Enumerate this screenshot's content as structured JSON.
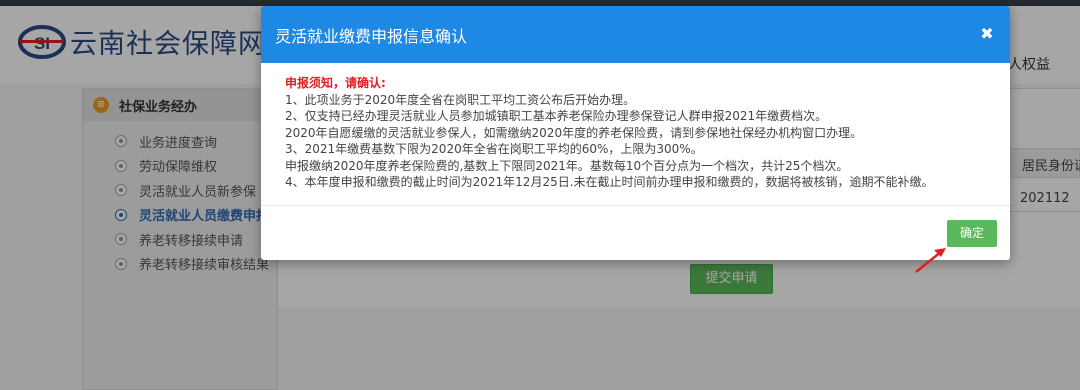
{
  "header": {
    "site_title": "云南社会保障网上",
    "rights_link": "人权益"
  },
  "sidebar": {
    "title": "社保业务经办",
    "items": [
      {
        "label": "业务进度查询"
      },
      {
        "label": "劳动保障维权"
      },
      {
        "label": "灵活就业人员新参保"
      },
      {
        "label": "灵活就业人员缴费申报",
        "active": true
      },
      {
        "label": "养老转移接续申请"
      },
      {
        "label": "养老转移接续审核结果"
      }
    ]
  },
  "content": {
    "column_id": "居民身份证",
    "cell_value": "202112",
    "submit_label": "提交申请"
  },
  "modal": {
    "title": "灵活就业缴费申报信息确认",
    "notice_title": "申报须知，请确认:",
    "lines": [
      "1、此项业务于2020年度全省在岗职工平均工资公布后开始办理。",
      "2、仅支持已经办理灵活就业人员参加城镇职工基本养老保险办理参保登记人群申报2021年缴费档次。",
      "2020年自愿缓缴的灵活就业参保人，如需缴纳2020年度的养老保险费，请到参保地社保经办机构窗口办理。",
      "3、2021年缴费基数下限为2020年全省在岗职工平均的60%，上限为300%。",
      "申报缴纳2020年度养老保险费的,基数上下限同2021年。基数每10个百分点为一个档次，共计25个档次。",
      "4、本年度申报和缴费的截止时间为2021年12月25日.未在截止时间前办理申报和缴费的，数据将被核销，逾期不能补缴。"
    ],
    "ok_label": "确定"
  },
  "colors": {
    "modal_header": "#1e88e5",
    "ok_button": "#5cb85c",
    "notice": "#e02020"
  }
}
